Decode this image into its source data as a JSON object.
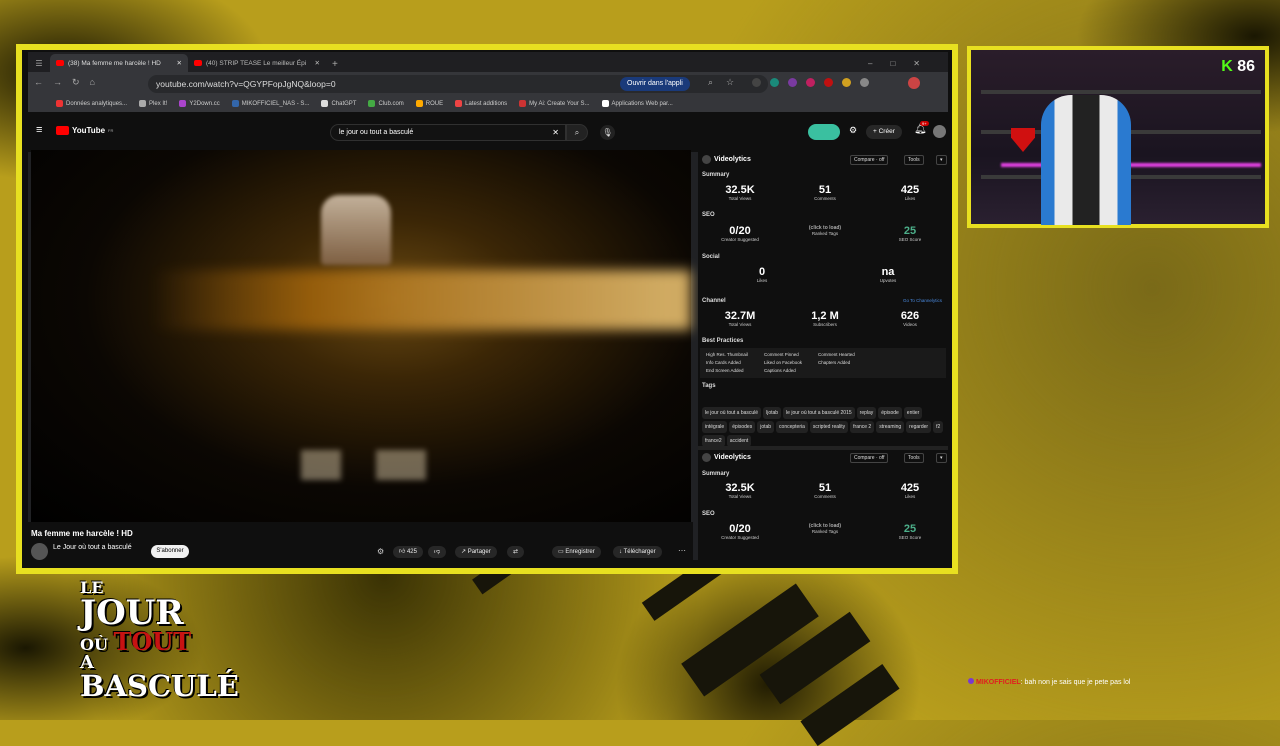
{
  "browser": {
    "tabs": [
      {
        "label": "(38) Ma femme me harcèle ! HD",
        "active": true
      },
      {
        "label": "(40) STRIP TEASE Le meilleur Épi",
        "active": false
      }
    ],
    "url": "youtube.com/watch?v=QGYPFopJgNQ&loop=0",
    "open_app": "Ouvrir dans l'appli",
    "bookmarks": [
      "Données analytiques...",
      "Plex It!",
      "Y2Down.cc",
      "MIKOFFICIEL_NAS - S...",
      "ChatGPT",
      "Club.com",
      "ROUE",
      "Latest additions",
      "My Ai: Create Your S...",
      "Applications Web par..."
    ]
  },
  "youtube": {
    "logo": "YouTube",
    "logo_sup": "FR",
    "search_value": "le jour ou tout a basculé",
    "create": "Créer",
    "notif_count": "9+",
    "video_title": "Ma femme me harcèle ! HD",
    "channel": "Le Jour où tout a basculé",
    "subscribe": "S'abonner",
    "likes": "425",
    "share": "Partager",
    "save": "Enregistrer",
    "download": "Télécharger"
  },
  "videolytics": {
    "name": "Videolytics",
    "compare": "Compare · off",
    "tools": "Tools",
    "summary_label": "Summary",
    "summary": [
      {
        "v": "32.5K",
        "l": "Total Views"
      },
      {
        "v": "51",
        "l": "Comments"
      },
      {
        "v": "425",
        "l": "Likes"
      }
    ],
    "seo_label": "SEO",
    "seo": [
      {
        "v": "0/20",
        "l": "Creator Suggested"
      },
      {
        "v": "(click to load)",
        "l": "Ranked Tags"
      },
      {
        "v": "25",
        "l": "SEO Score"
      }
    ],
    "social_label": "Social",
    "social": [
      {
        "v": "0",
        "l": "Likes"
      },
      {
        "v": "na",
        "l": "Upvotes"
      }
    ],
    "channel_label": "Channel",
    "channel_link": "Go To Channelytics",
    "channel_stats": [
      {
        "v": "32.7M",
        "l": "Total Views"
      },
      {
        "v": "1,2 M",
        "l": "Subscribers"
      },
      {
        "v": "626",
        "l": "Videos"
      }
    ],
    "bp_label": "Best Practices",
    "bp": [
      "High Res. Thumbnail",
      "Comment Pinned",
      "Comment Hearted",
      "Info Cards Added",
      "Liked on Facebook",
      "Chapters Added",
      "End Screen Added",
      "Captions Added"
    ],
    "tags_label": "Tags",
    "tags": [
      "le jour où tout a basculé",
      "ljotab",
      "le jour où tout a basculé 2015",
      "replay",
      "épisode",
      "entier",
      "intégrale",
      "épisodes",
      "jotab",
      "concepteria",
      "scripted reality",
      "france 2",
      "streaming",
      "regarder",
      "f2",
      "france2",
      "accident"
    ]
  },
  "stream": {
    "kick_count": "86",
    "chat_user": "MIKOFFICIEL",
    "chat_msg": ": bah non je sais que je pete pas lol",
    "logo_lines": [
      "LE",
      "JOUR",
      "OÙ",
      "TOUT",
      "A",
      "BASCULÉ"
    ]
  },
  "colors": {
    "accent": "#e8e020",
    "youtube_red": "#ff0000",
    "kick_green": "#53fc18",
    "seo_green": "#4caf8a"
  }
}
